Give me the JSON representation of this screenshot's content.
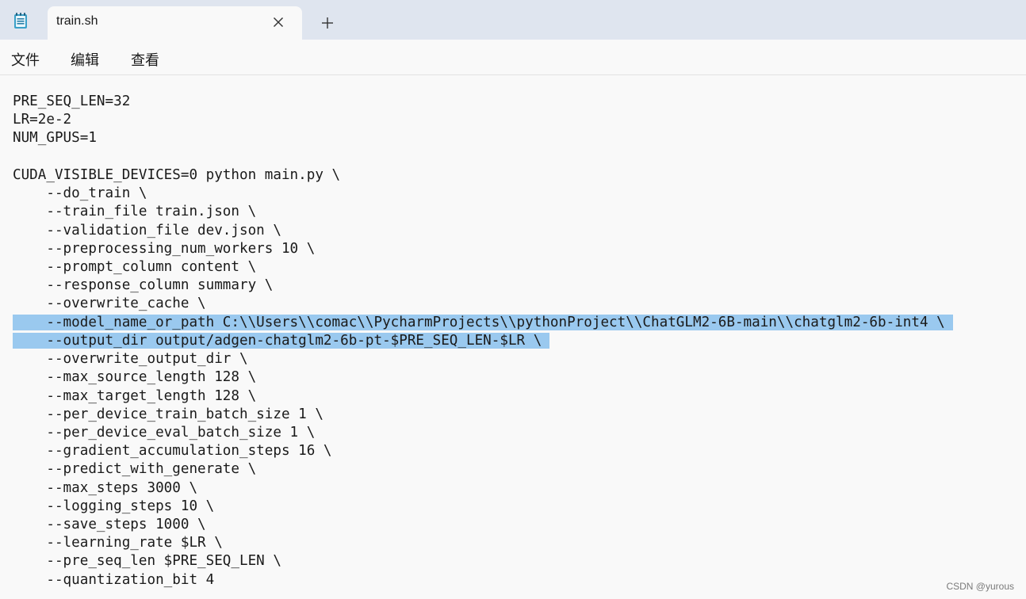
{
  "app": {
    "icon": "notepad-icon",
    "tab_title": "train.sh",
    "close_icon": "close-icon",
    "new_tab_icon": "plus-icon"
  },
  "menu": {
    "items": [
      "文件",
      "编辑",
      "查看"
    ]
  },
  "editor": {
    "lines": [
      "PRE_SEQ_LEN=32",
      "LR=2e-2",
      "NUM_GPUS=1",
      "",
      "CUDA_VISIBLE_DEVICES=0 python main.py \\",
      "    --do_train \\",
      "    --train_file train.json \\",
      "    --validation_file dev.json \\",
      "    --preprocessing_num_workers 10 \\",
      "    --prompt_column content \\",
      "    --response_column summary \\",
      "    --overwrite_cache \\",
      "    --model_name_or_path C:\\\\Users\\\\comac\\\\PycharmProjects\\\\pythonProject\\\\ChatGLM2-6B-main\\\\chatglm2-6b-int4 \\",
      "    --output_dir output/adgen-chatglm2-6b-pt-$PRE_SEQ_LEN-$LR \\",
      "    --overwrite_output_dir \\",
      "    --max_source_length 128 \\",
      "    --max_target_length 128 \\",
      "    --per_device_train_batch_size 1 \\",
      "    --per_device_eval_batch_size 1 \\",
      "    --gradient_accumulation_steps 16 \\",
      "    --predict_with_generate \\",
      "    --max_steps 3000 \\",
      "    --logging_steps 10 \\",
      "    --save_steps 1000 \\",
      "    --learning_rate $LR \\",
      "    --pre_seq_len $PRE_SEQ_LEN \\",
      "    --quantization_bit 4"
    ],
    "selected_lines": [
      12,
      13
    ],
    "selection_color": "#9ac9ef"
  },
  "watermark": "CSDN @yurous",
  "colors": {
    "titlebar_bg": "#dfe5ef",
    "tab_bg": "#f9f9f9",
    "text": "#1a1a1a"
  }
}
